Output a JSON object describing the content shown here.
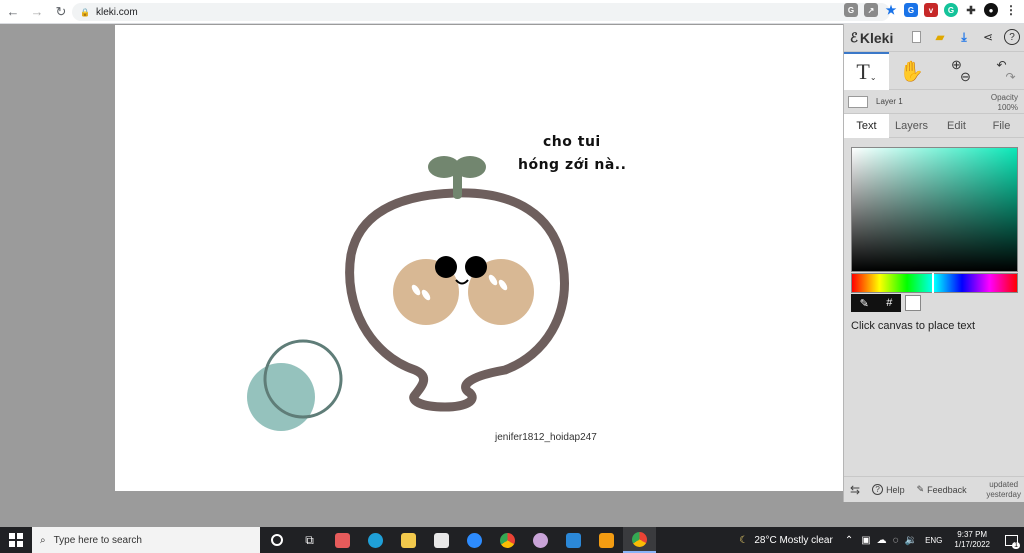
{
  "browser": {
    "url": "kleki.com"
  },
  "canvas": {
    "speech_line1": "cho tui",
    "speech_line2": "hóng zới nà..",
    "watermark": "jenifer1812_hoidap247"
  },
  "kleki": {
    "logo": "Kleki",
    "layer_name": "Layer 1",
    "opacity_label": "Opacity",
    "opacity_value": "100%",
    "tabs": [
      "Text",
      "Layers",
      "Edit",
      "File"
    ],
    "active_tab": "Text",
    "hex_label": "#",
    "hint": "Click canvas to place text",
    "help": "Help",
    "feedback": "Feedback",
    "updated_line1": "updated",
    "updated_line2": "yesterday",
    "tool_text_glyph": "T"
  },
  "taskbar": {
    "search_placeholder": "Type here to search",
    "weather": "28°C  Mostly clear",
    "lang": "ENG",
    "time": "9:37 PM",
    "date": "1/17/2022",
    "notif_count": "1"
  },
  "colors": {
    "stroke": "#6e5f5d",
    "sprout": "#72866f",
    "cheek": "#d8b894",
    "circle_fill": "#95c2bd",
    "circle_ring": "#5f7d78",
    "picker_hue": "#0be8b8"
  }
}
